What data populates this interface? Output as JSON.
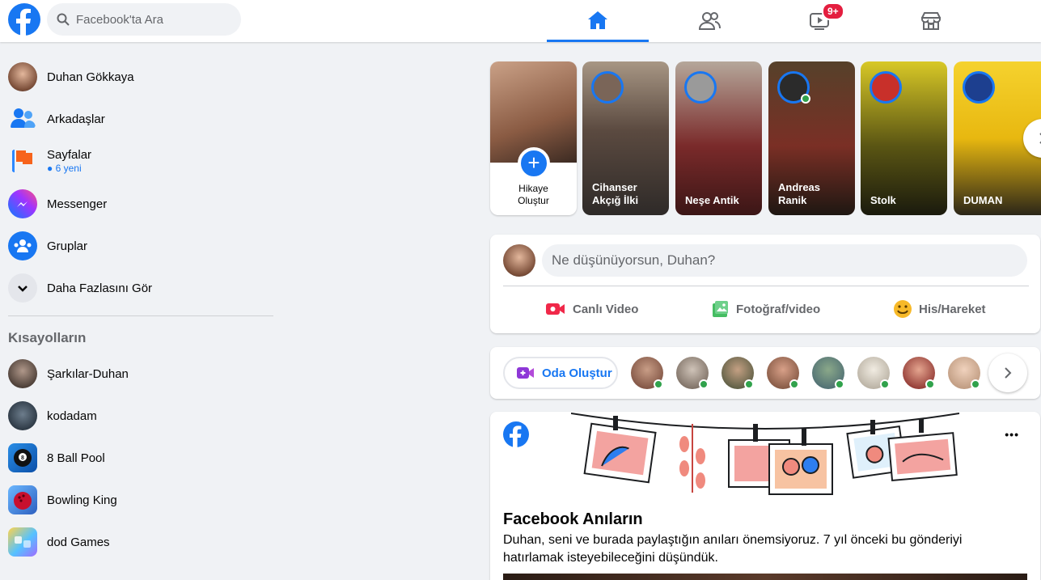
{
  "topbar": {
    "search_placeholder": "Facebook'ta Ara",
    "notification_badge": "9+",
    "accent": "#1877f2"
  },
  "sidebar": {
    "items": [
      {
        "label": "Duhan Gökkaya"
      },
      {
        "label": "Arkadaşlar"
      },
      {
        "label": "Sayfalar",
        "sub": "● 6 yeni"
      },
      {
        "label": "Messenger"
      },
      {
        "label": "Gruplar"
      },
      {
        "label": "Daha Fazlasını Gör"
      }
    ],
    "shortcuts_title": "Kısayolların",
    "shortcuts": [
      {
        "label": "Şarkılar-Duhan"
      },
      {
        "label": "kodadam"
      },
      {
        "label": "8 Ball Pool"
      },
      {
        "label": "Bowling King"
      },
      {
        "label": "dod Games"
      }
    ]
  },
  "stories": {
    "create_label_1": "Hikaye",
    "create_label_2": "Oluştur",
    "items": [
      {
        "line1": "Cihanser",
        "line2": "Akçığ İlki"
      },
      {
        "line1": "Neşe Antik",
        "line2": ""
      },
      {
        "line1": "Andreas",
        "line2": "Ranik"
      },
      {
        "line1": "Stolk",
        "line2": ""
      },
      {
        "line1": "DUMAN",
        "line2": ""
      }
    ]
  },
  "composer": {
    "placeholder": "Ne düşünüyorsun, Duhan?",
    "actions": [
      "Canlı Video",
      "Fotoğraf/video",
      "His/Hareket"
    ]
  },
  "rooms": {
    "button_label": "Oda Oluştur"
  },
  "memories": {
    "title": "Facebook Anıların",
    "body": "Duhan, seni ve burada paylaştığın anıları önemsiyoruz. 7 yıl önceki bu gönderiyi hatırlamak isteyebileceğini düşündük.",
    "more": "•••"
  }
}
